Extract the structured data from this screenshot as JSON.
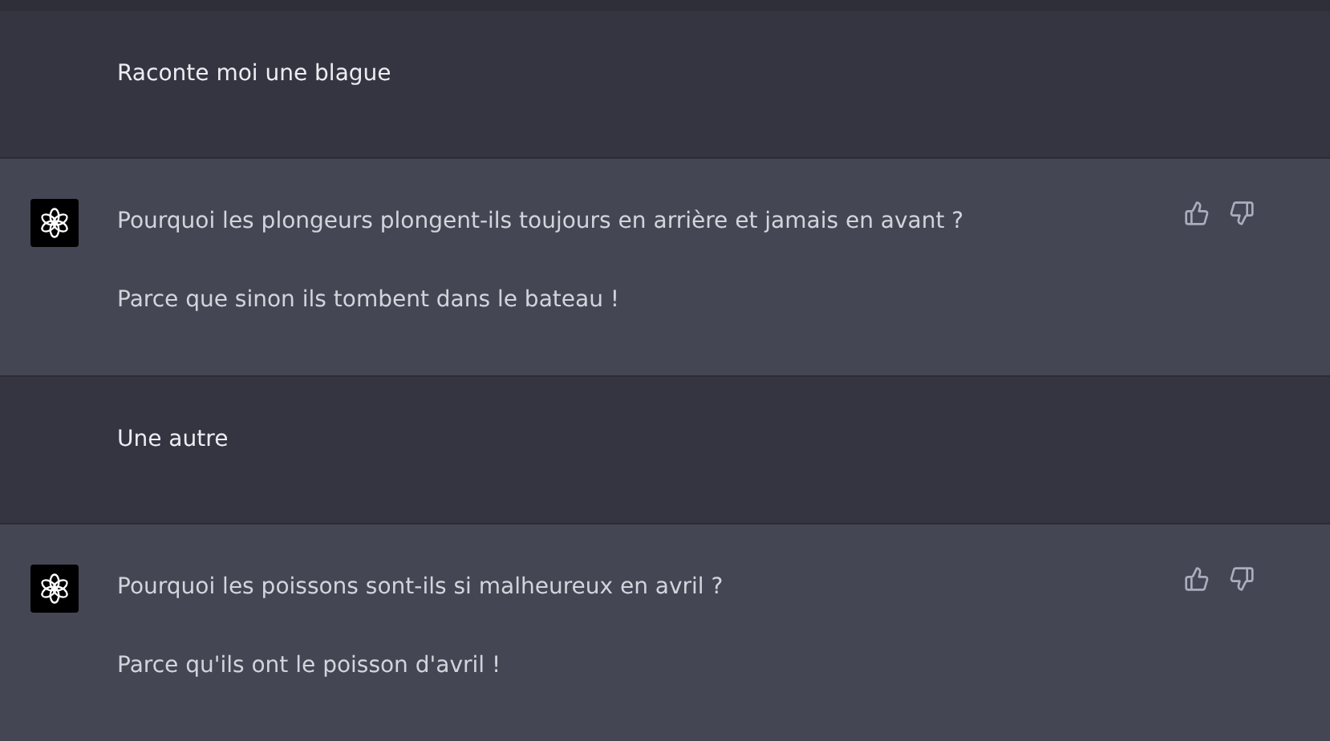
{
  "messages": [
    {
      "kind": "user",
      "paragraphs": [
        "Raconte moi une blague"
      ]
    },
    {
      "kind": "assistant",
      "paragraphs": [
        "Pourquoi les plongeurs plongent-ils toujours en arrière et jamais en avant ?",
        "Parce que sinon ils tombent dans le bateau !"
      ]
    },
    {
      "kind": "user",
      "paragraphs": [
        "Une autre"
      ]
    },
    {
      "kind": "assistant",
      "paragraphs": [
        "Pourquoi les poissons sont-ils si malheureux en avril ?",
        "Parce qu'ils ont le poisson d'avril !"
      ]
    }
  ]
}
